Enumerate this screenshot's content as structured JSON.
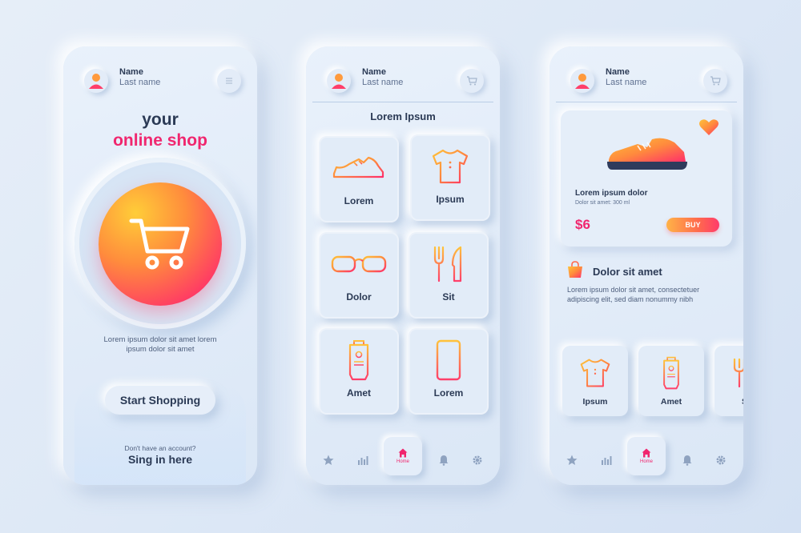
{
  "colors": {
    "accent_pink": "#f0266e",
    "accent_orange": "#ff8d3c",
    "accent_yellow": "#ffcd38",
    "text_dark": "#2b3a55",
    "background": "#dde8f6"
  },
  "user": {
    "name": "Name",
    "last_name": "Last name"
  },
  "screen1": {
    "title_line1": "your",
    "title_line2": "online shop",
    "description": "Lorem ipsum dolor sit amet lorem ipsum dolor sit amet",
    "start_button": "Start Shopping",
    "account_question": "Don't have an account?",
    "sign_in": "Sing in here",
    "header_icon": "menu-icon",
    "hero_icon": "shopping-cart-icon"
  },
  "screen2": {
    "title": "Lorem Ipsum",
    "header_icon": "cart-icon",
    "categories": [
      {
        "label": "Lorem",
        "icon": "sneaker-icon"
      },
      {
        "label": "Ipsum",
        "icon": "tshirt-icon"
      },
      {
        "label": "Dolor",
        "icon": "glasses-icon"
      },
      {
        "label": "Sit",
        "icon": "fork-knife-icon"
      },
      {
        "label": "Amet",
        "icon": "cream-tube-icon"
      },
      {
        "label": "Lorem",
        "icon": "smartphone-icon"
      }
    ]
  },
  "nav": {
    "items": [
      "star-icon",
      "chart-icon",
      "home-icon",
      "bell-icon",
      "gear-icon"
    ],
    "home_label": "Home"
  },
  "screen3": {
    "header_icon": "cart-icon",
    "product": {
      "name": "Lorem ipsum dolor",
      "subtitle": "Dolor sit amet: 300 ml",
      "price": "$6",
      "buy_label": "BUY"
    },
    "section_title": "Dolor sit amet",
    "section_desc": "Lorem ipsum dolor sit amet, consectetuer adipiscing elit, sed diam nonummy nibh",
    "mini_items": [
      {
        "label": "Ipsum",
        "icon": "tshirt-icon"
      },
      {
        "label": "Amet",
        "icon": "cream-tube-icon"
      },
      {
        "label": "S",
        "icon": "fork-icon"
      }
    ]
  }
}
